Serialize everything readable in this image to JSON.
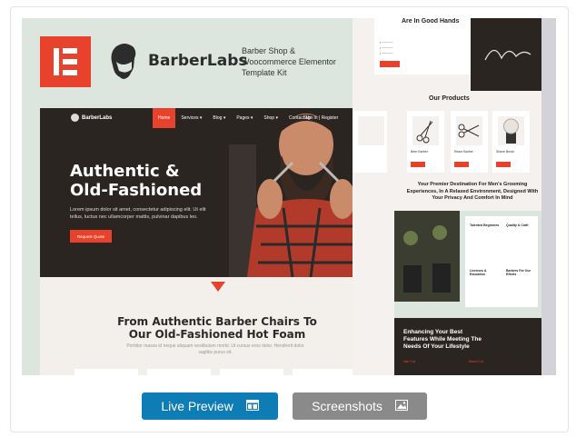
{
  "elementor_logo": "elementor-logo",
  "brand": {
    "name": "BarberLabs",
    "kit_text": "Barber Shop & Woocommerce Elementor Template Kit"
  },
  "hero": {
    "nav_brand": "BarberLabs",
    "nav_items": [
      "Home",
      "Services ▾",
      "Blog ▾",
      "Pages ▾",
      "Shop ▾",
      "Contact Us"
    ],
    "nav_right": "Sign In | Register",
    "headline_line1": "Authentic &",
    "headline_line2": "Old-Fashioned",
    "body": "Lorem ipsum dolor sit amet, consectetur adipiscing elit. Ut elit tellus, luctus nec ullamcorper mattis, pulvinar dapibus leo.",
    "button": "Request Quote"
  },
  "section": {
    "title_line1": "From Authentic Barber Chairs To",
    "title_line2": "Our Old-Fashioned Hot Foam",
    "subtitle": "Porttitor massa id neque aliquam vestibulum morbi. Ut cursus eros dolor. Hendrerit dolor sagittis purus sit."
  },
  "right_panel": {
    "care_title": "Are In Good Hands",
    "products_title": "Our Products",
    "products": [
      {
        "name": "Beer Barber"
      },
      {
        "name": "Razor Barber"
      },
      {
        "name": "Shave Brush"
      }
    ],
    "premier_text": "Your Premier Destination For Men's Grooming Experiences, In A Relaxed Environment, Designed With Your Privacy And Comfort In Mind",
    "features": [
      "Talented Beginners",
      "Quality & Craft",
      "Licenses & Education",
      "Barbers For Our Efforts"
    ],
    "dark_title": "Enhancing Your Best Features While Meeting The Needs Of Your Lifestyle",
    "dark_labels": [
      "Hair Cut",
      "Beard Cut"
    ]
  },
  "buttons": {
    "live_preview": "Live Preview",
    "screenshots": "Screenshots"
  },
  "colors": {
    "accent": "#e8412c",
    "primary_button": "#0e7cb5",
    "secondary_button": "#8a8a8a",
    "dark": "#2b2522",
    "mint": "#dde5df"
  }
}
